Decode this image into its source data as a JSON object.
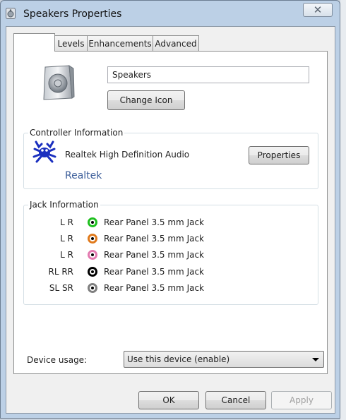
{
  "window": {
    "title": "Speakers Properties",
    "close_glyph": "✕"
  },
  "tabs": [
    {
      "label": ""
    },
    {
      "label": "Levels"
    },
    {
      "label": "Enhancements"
    },
    {
      "label": "Advanced"
    }
  ],
  "device": {
    "name_value": "Speakers",
    "change_icon_label": "Change Icon"
  },
  "controller": {
    "group_label": "Controller Information",
    "name": "Realtek High Definition Audio",
    "vendor": "Realtek",
    "properties_label": "Properties",
    "vendor_color": "#3c5e9a"
  },
  "jack": {
    "group_label": "Jack Information",
    "rows": [
      {
        "channels": "L R",
        "color": "#1fbf1f",
        "label": "Rear Panel 3.5 mm Jack"
      },
      {
        "channels": "L R",
        "color": "#e07a1c",
        "label": "Rear Panel 3.5 mm Jack"
      },
      {
        "channels": "L R",
        "color": "#e37ab0",
        "label": "Rear Panel 3.5 mm Jack"
      },
      {
        "channels": "RL RR",
        "color": "#000000",
        "label": "Rear Panel 3.5 mm Jack"
      },
      {
        "channels": "SL SR",
        "color": "#7f7f7f",
        "label": "Rear Panel 3.5 mm Jack"
      }
    ]
  },
  "usage": {
    "label": "Device usage:",
    "selected": "Use this device (enable)"
  },
  "buttons": {
    "ok": "OK",
    "cancel": "Cancel",
    "apply": "Apply"
  }
}
